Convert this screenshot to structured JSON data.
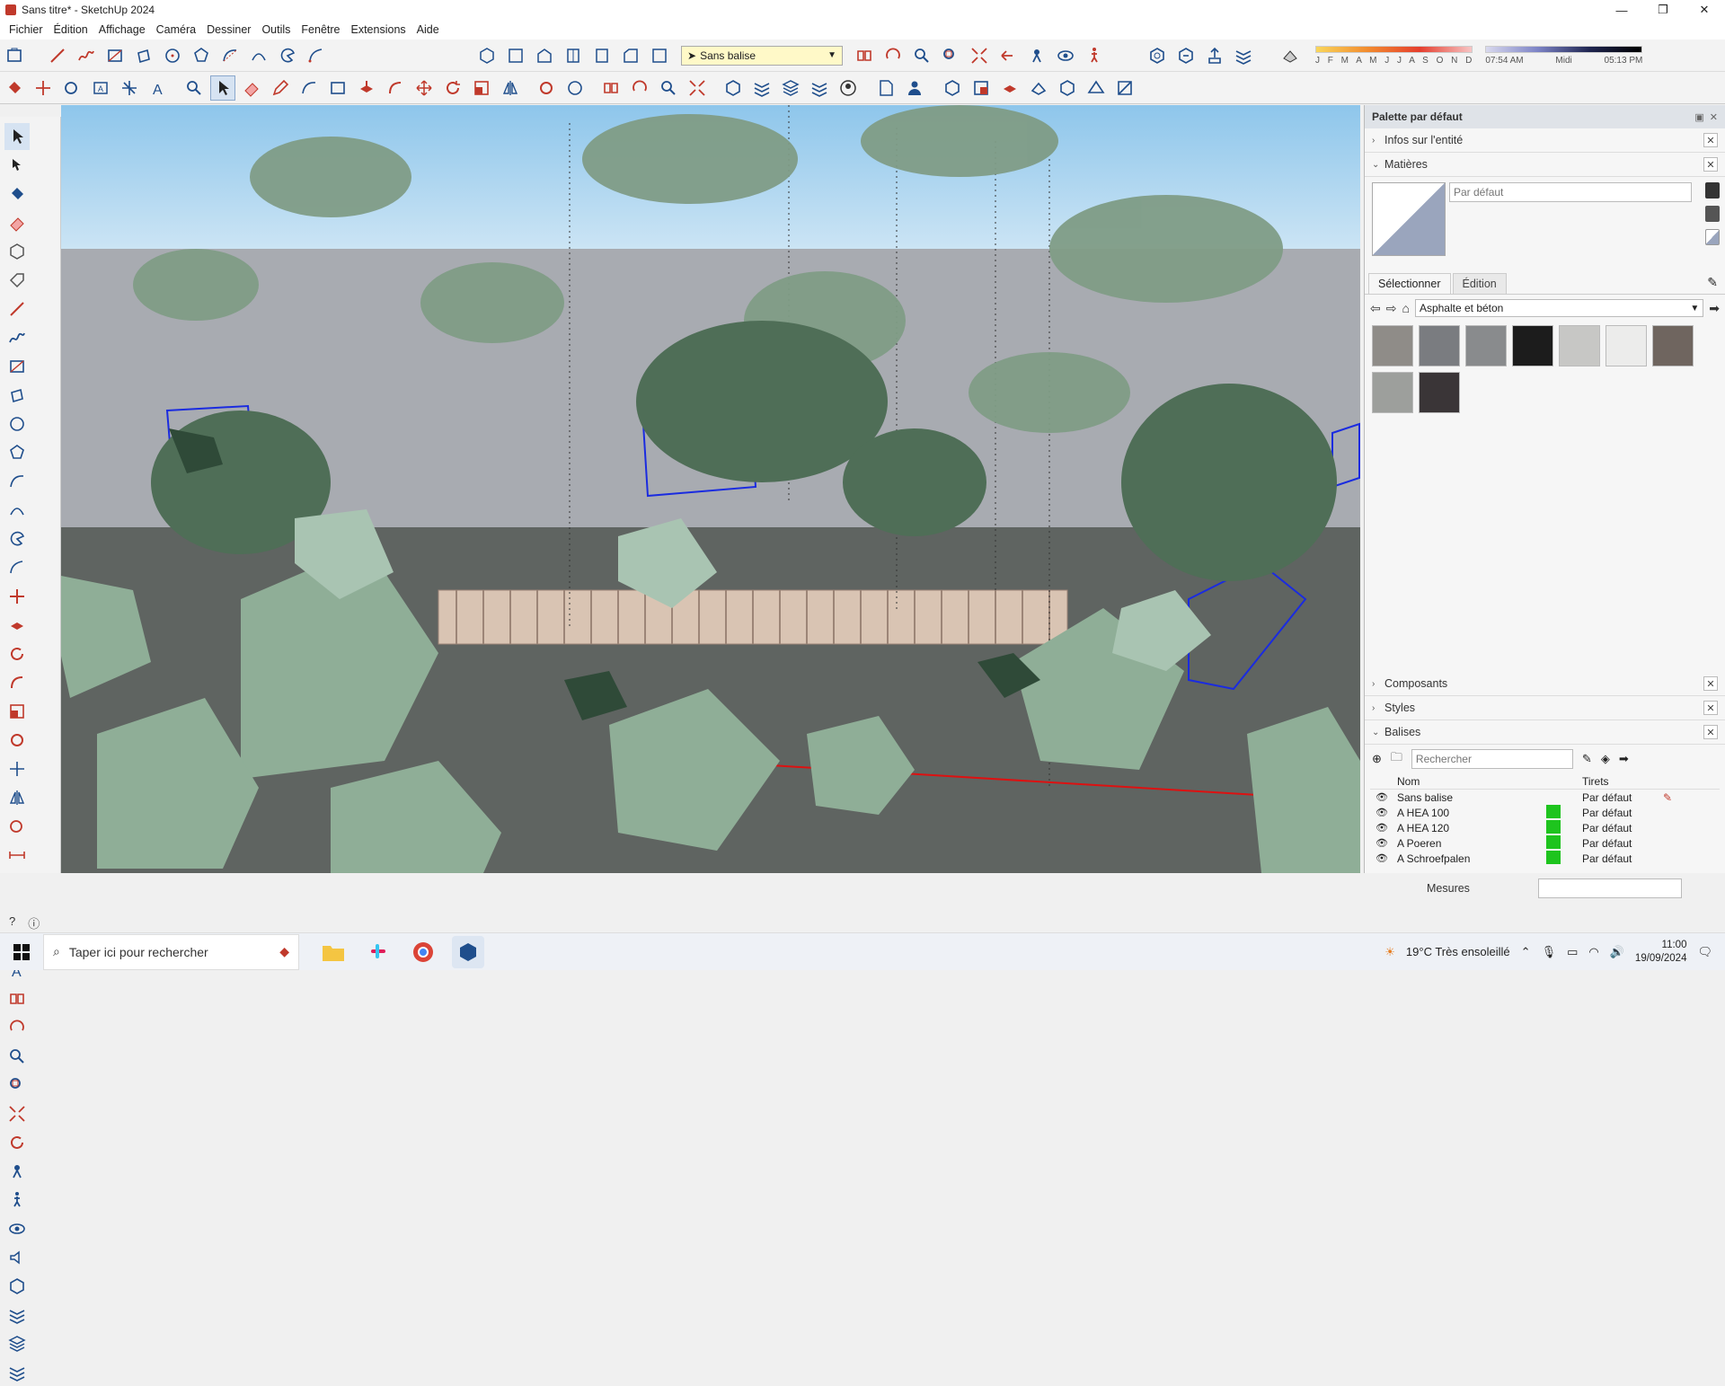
{
  "window": {
    "title": "Sans titre* - SketchUp 2024",
    "minimize": "—",
    "maximize": "❐",
    "close": "✕"
  },
  "menu": [
    "Fichier",
    "Édition",
    "Affichage",
    "Caméra",
    "Dessiner",
    "Outils",
    "Fenêtre",
    "Extensions",
    "Aide"
  ],
  "toolbar": {
    "active_tag": "Sans balise",
    "shadow_months": "J F M A M J J A S O N D",
    "sunrise": "07:54 AM",
    "noon": "Midi",
    "sunset": "05:13 PM"
  },
  "panel": {
    "title": "Palette par défaut",
    "entity_info": "Infos sur l'entité",
    "materials": "Matières",
    "material_name_placeholder": "Par défaut",
    "tab_select": "Sélectionner",
    "tab_edit": "Édition",
    "library": "Asphalte et béton",
    "swatch_colors": [
      "#8f8c88",
      "#7a7c80",
      "#898b8d",
      "#1c1c1c",
      "#c7c7c5",
      "#ececeb",
      "#6f655f",
      "#9d9f9c",
      "#3a3537"
    ],
    "components": "Composants",
    "styles": "Styles",
    "tags": "Balises",
    "tags_search_placeholder": "Rechercher",
    "tags_col_name": "Nom",
    "tags_col_dash": "Tirets",
    "tags_rows": [
      {
        "name": "Sans balise",
        "dash": "Par défaut",
        "color": ""
      },
      {
        "name": "A HEA 100",
        "dash": "Par défaut",
        "color": "#1ec41e"
      },
      {
        "name": "A HEA 120",
        "dash": "Par défaut",
        "color": "#1ec41e"
      },
      {
        "name": "A Poeren",
        "dash": "Par défaut",
        "color": "#1ec41e"
      },
      {
        "name": "A Schroefpalen",
        "dash": "Par défaut",
        "color": "#1ec41e"
      }
    ]
  },
  "status": {
    "measurements_label": "Mesures"
  },
  "taskbar": {
    "search_placeholder": "Taper ici pour rechercher",
    "weather": "19°C  Très ensoleillé",
    "time": "11:00",
    "date": "19/09/2024"
  }
}
